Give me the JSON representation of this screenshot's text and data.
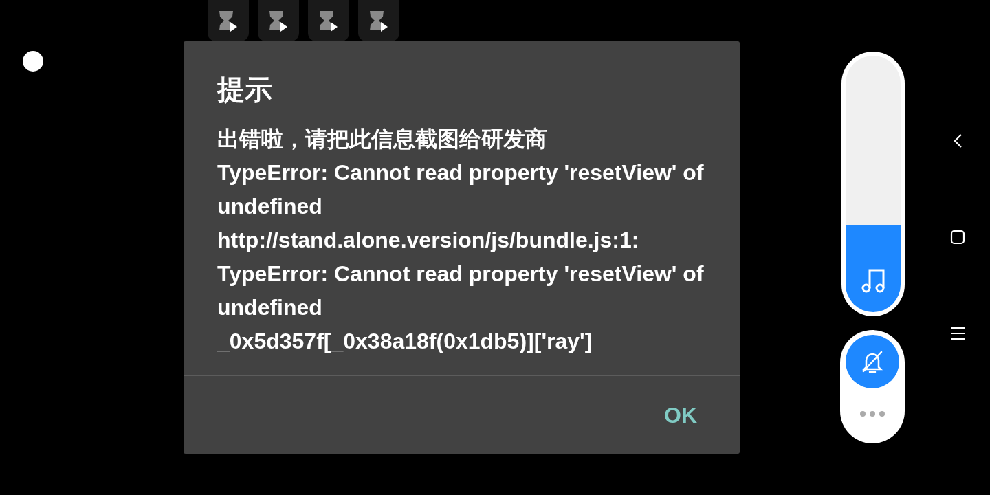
{
  "app_tiles": [
    {
      "kind": "hourglass-play"
    },
    {
      "kind": "hourglass-play"
    },
    {
      "kind": "hourglass-play"
    },
    {
      "kind": "hourglass-play"
    }
  ],
  "dialog": {
    "title": "提示",
    "message": [
      "出错啦，请把此信息截图给研发商",
      "TypeError: Cannot read property 'resetView' of undefined",
      "http://stand.alone.version/js/bundle.js:1:",
      "TypeError: Cannot read property 'resetView' of undefined",
      "_0x5d357f[_0x38a18f(0x1db5)]['ray']"
    ],
    "buttons": [
      "OK"
    ]
  },
  "volume": {
    "level": 0.34
  },
  "ringer": {
    "muted": true
  },
  "nav_bar": [
    {
      "kind": "back"
    },
    {
      "kind": "home"
    },
    {
      "kind": "menu"
    }
  ]
}
